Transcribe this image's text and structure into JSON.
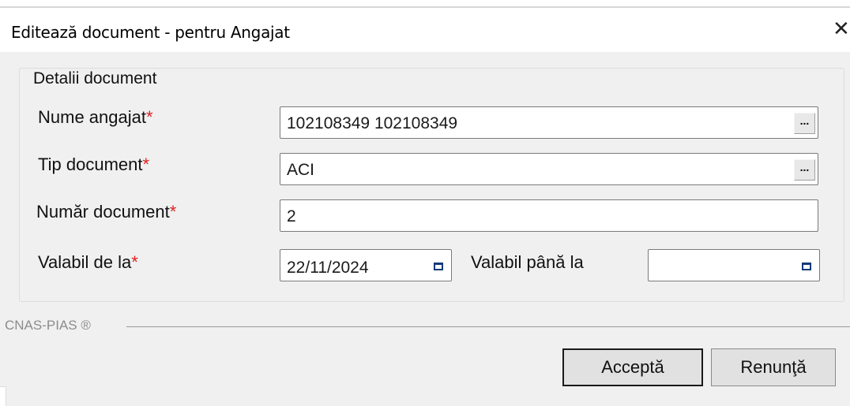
{
  "window": {
    "title": "Editează document - pentru Angajat",
    "close_symbol": "✕"
  },
  "group": {
    "legend": "Detalii document"
  },
  "fields": {
    "nume_angajat": {
      "label": "Nume angajat",
      "required_mark": "*",
      "value": "102108349 102108349",
      "button_label": "..."
    },
    "tip_document": {
      "label": "Tip document",
      "required_mark": "*",
      "value": "ACI",
      "button_label": "..."
    },
    "numar_document": {
      "label": "Număr document",
      "required_mark": "*",
      "value": "2"
    },
    "valabil_de_la": {
      "label": "Valabil de la",
      "required_mark": "*",
      "value": "22/11/2024",
      "icon": "calendar-icon"
    },
    "valabil_pana_la": {
      "label": "Valabil până la",
      "value": "",
      "icon": "calendar-icon"
    }
  },
  "footer": {
    "brand": "CNAS-PIAS ®"
  },
  "buttons": {
    "accept": "Acceptă",
    "cancel": "Renunţă"
  },
  "colors": {
    "required": "#e02020",
    "background": "#f0f0f0",
    "calendar_icon": "#123a7a"
  }
}
